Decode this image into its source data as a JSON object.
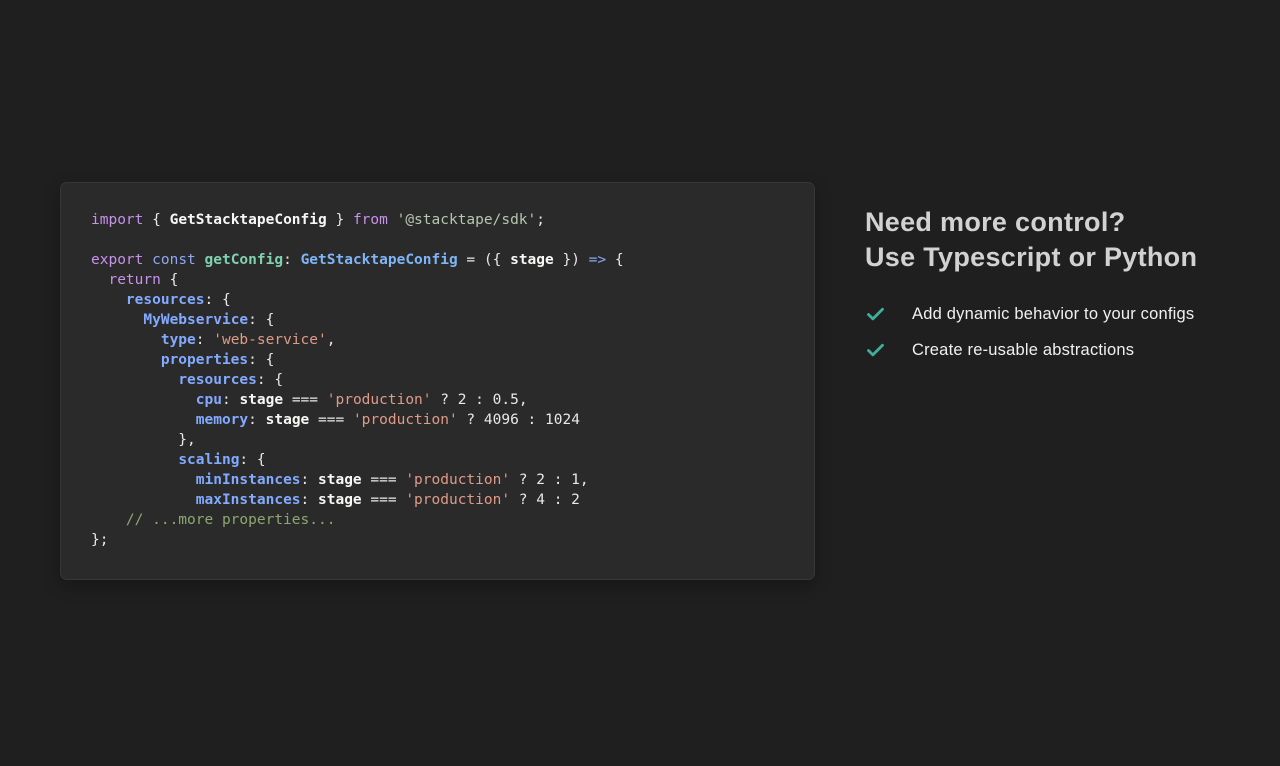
{
  "colors": {
    "page_bg": "#1f1f1f",
    "card_bg": "#2a2a2b",
    "check": "#3fae9b"
  },
  "code": {
    "lines": [
      [
        {
          "t": "import",
          "c": "kw"
        },
        {
          "t": " { ",
          "c": "pl"
        },
        {
          "t": "GetStacktapeConfig",
          "c": "var"
        },
        {
          "t": " } ",
          "c": "pl"
        },
        {
          "t": "from",
          "c": "kw"
        },
        {
          "t": " ",
          "c": "pl"
        },
        {
          "t": "'@stacktape/sdk'",
          "c": "strmod"
        },
        {
          "t": ";",
          "c": "pl"
        }
      ],
      [],
      [
        {
          "t": "export",
          "c": "kw"
        },
        {
          "t": " ",
          "c": "pl"
        },
        {
          "t": "const",
          "c": "kwb"
        },
        {
          "t": " ",
          "c": "pl"
        },
        {
          "t": "getConfig",
          "c": "fn"
        },
        {
          "t": ": ",
          "c": "pl"
        },
        {
          "t": "GetStacktapeConfig",
          "c": "type"
        },
        {
          "t": " = ({ ",
          "c": "pl"
        },
        {
          "t": "stage",
          "c": "var"
        },
        {
          "t": " }) ",
          "c": "pl"
        },
        {
          "t": "=>",
          "c": "kwb"
        },
        {
          "t": " {",
          "c": "pl"
        }
      ],
      [
        {
          "t": "  ",
          "c": "pl"
        },
        {
          "t": "return",
          "c": "kw"
        },
        {
          "t": " {",
          "c": "pl"
        }
      ],
      [
        {
          "t": "    ",
          "c": "pl"
        },
        {
          "t": "resources",
          "c": "prop"
        },
        {
          "t": ": {",
          "c": "pl"
        }
      ],
      [
        {
          "t": "      ",
          "c": "pl"
        },
        {
          "t": "MyWebservice",
          "c": "prop"
        },
        {
          "t": ": {",
          "c": "pl"
        }
      ],
      [
        {
          "t": "        ",
          "c": "pl"
        },
        {
          "t": "type",
          "c": "prop"
        },
        {
          "t": ": ",
          "c": "pl"
        },
        {
          "t": "'web-service'",
          "c": "str"
        },
        {
          "t": ",",
          "c": "pl"
        }
      ],
      [
        {
          "t": "        ",
          "c": "pl"
        },
        {
          "t": "properties",
          "c": "prop"
        },
        {
          "t": ": {",
          "c": "pl"
        }
      ],
      [
        {
          "t": "          ",
          "c": "pl"
        },
        {
          "t": "resources",
          "c": "prop"
        },
        {
          "t": ": {",
          "c": "pl"
        }
      ],
      [
        {
          "t": "            ",
          "c": "pl"
        },
        {
          "t": "cpu",
          "c": "prop"
        },
        {
          "t": ": ",
          "c": "pl"
        },
        {
          "t": "stage",
          "c": "var"
        },
        {
          "t": " === ",
          "c": "pl"
        },
        {
          "t": "'production'",
          "c": "str"
        },
        {
          "t": " ? 2 : 0.5,",
          "c": "pl"
        }
      ],
      [
        {
          "t": "            ",
          "c": "pl"
        },
        {
          "t": "memory",
          "c": "prop"
        },
        {
          "t": ": ",
          "c": "pl"
        },
        {
          "t": "stage",
          "c": "var"
        },
        {
          "t": " === ",
          "c": "pl"
        },
        {
          "t": "'production'",
          "c": "str"
        },
        {
          "t": " ? 4096 : 1024",
          "c": "pl"
        }
      ],
      [
        {
          "t": "          },",
          "c": "pl"
        }
      ],
      [
        {
          "t": "          ",
          "c": "pl"
        },
        {
          "t": "scaling",
          "c": "prop"
        },
        {
          "t": ": {",
          "c": "pl"
        }
      ],
      [
        {
          "t": "            ",
          "c": "pl"
        },
        {
          "t": "minInstances",
          "c": "prop"
        },
        {
          "t": ": ",
          "c": "pl"
        },
        {
          "t": "stage",
          "c": "var"
        },
        {
          "t": " === ",
          "c": "pl"
        },
        {
          "t": "'production'",
          "c": "str"
        },
        {
          "t": " ? 2 : 1,",
          "c": "pl"
        }
      ],
      [
        {
          "t": "            ",
          "c": "pl"
        },
        {
          "t": "maxInstances",
          "c": "prop"
        },
        {
          "t": ": ",
          "c": "pl"
        },
        {
          "t": "stage",
          "c": "var"
        },
        {
          "t": " === ",
          "c": "pl"
        },
        {
          "t": "'production'",
          "c": "str"
        },
        {
          "t": " ? 4 : 2",
          "c": "pl"
        }
      ],
      [
        {
          "t": "    ",
          "c": "pl"
        },
        {
          "t": "// ...more properties...",
          "c": "cm"
        }
      ],
      [
        {
          "t": "};",
          "c": "pl"
        }
      ]
    ]
  },
  "right": {
    "title_line1": "Need more control?",
    "title_line2": "Use Typescript or Python",
    "items": [
      {
        "icon": "check-icon",
        "label": "Add dynamic behavior to your configs"
      },
      {
        "icon": "check-icon",
        "label": "Create re-usable abstractions"
      }
    ]
  }
}
